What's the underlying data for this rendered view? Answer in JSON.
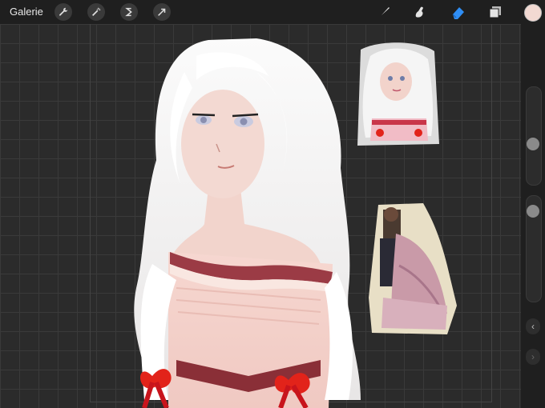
{
  "toolbar": {
    "gallery_label": "Galerie",
    "left_tools": [
      "wrench-icon",
      "magic-wand-icon",
      "selection-icon",
      "transform-arrow-icon"
    ],
    "right_tools": [
      "brush-icon",
      "smudge-icon",
      "eraser-icon",
      "layers-icon"
    ],
    "active_tool": "eraser-icon",
    "color": "#f2d9d2"
  },
  "sidebar": {
    "size_slider": 0.6,
    "opacity_slider": 0.1,
    "undo_icon": "undo-chevron-icon",
    "redo_icon": "redo-chevron-icon"
  },
  "colors": {
    "accent": "#2f8ef5",
    "background": "#2b2b2b"
  }
}
